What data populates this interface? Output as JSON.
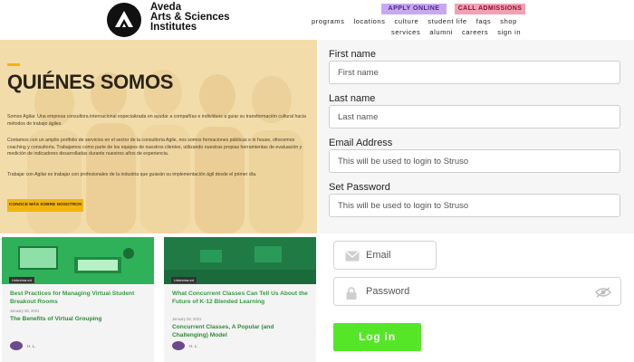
{
  "header": {
    "logo_line1": "Aveda",
    "logo_line2": "Arts & Sciences",
    "logo_line3": "Institutes",
    "apply_label": "APPLY ONLINE",
    "call_label": "CALL ADMISSIONS",
    "nav_primary": [
      "programs",
      "locations",
      "culture",
      "student life",
      "faqs",
      "shop"
    ],
    "nav_secondary": [
      "services",
      "alumni",
      "careers",
      "sign in"
    ]
  },
  "hero": {
    "title": "QUIÉNES SOMOS",
    "paragraph1": "Somos Agilar. Una empresa consultora internacional especializada en ayudar a compañías e individuos a guiar su transformación cultural hacia métodos de trabajo ágiles.",
    "paragraph2": "Contamos con un amplio portfolio de servicios en el sector de la consultoría Agile, nos somos formaciones públicas e in house, ofrecemos coaching y consultoría. Trabajamos como parte de los equipos de nuestros clientes, utilizando nuestras propias herramientas de evaluación y medición de indicadores desarrolladas durante nuestros años de experiencia.",
    "paragraph3": "Trabajar con Agilar es trabajar con profesionales de la industria que guiarán su implementación ágil desde el primer día.",
    "cta_label": "CONOCE MÁS SOBRE NOSOTROS"
  },
  "signup": {
    "first_name_label": "First name",
    "first_name_placeholder": "First name",
    "last_name_label": "Last name",
    "last_name_placeholder": "Last name",
    "email_label": "Email Address",
    "email_placeholder": "This will be used to login to Struso",
    "password_label": "Set Password",
    "password_placeholder": "This will be used to login to Struso"
  },
  "cards": [
    {
      "badge": "Unkrema.ed",
      "title": "Best Practices for Managing Virtual Student Breakout Rooms",
      "date": "January 28, 2021",
      "subtitle": "The Benefits of Virtual Grouping",
      "author": "H. L."
    },
    {
      "badge": "Unkrema.ed",
      "title": "What Concurrent Classes Can Tell Us About the Future of K-12 Blended Learning",
      "date": "January 28, 2021",
      "subtitle": "Concurrent Classes, A Popular (and Challenging) Model",
      "author": "H. L."
    }
  ],
  "login": {
    "email_label": "Email",
    "password_label": "Password",
    "button_label": "Log in"
  },
  "colors": {
    "hero_bg": "#f3dda8",
    "accent_yellow": "#f2b40f",
    "card_title_green": "#3a9a46",
    "login_button": "#55e628",
    "apply_bg": "#c9a8f0",
    "call_bg": "#f2a1b4"
  }
}
